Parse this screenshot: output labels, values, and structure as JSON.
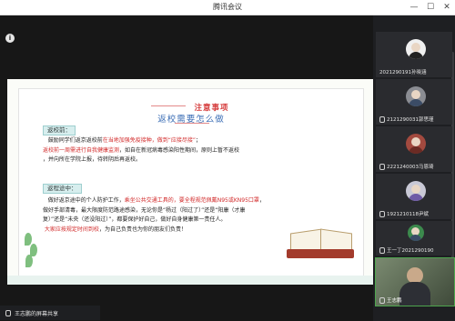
{
  "window": {
    "title": "腾讯会议",
    "minimize": "—",
    "maximize": "☐",
    "close": "✕"
  },
  "slide": {
    "banner_title": "注意事项",
    "heading": "返校需要怎么做",
    "sections": [
      {
        "label": "返校前：",
        "lines": [
          {
            "segments": [
              {
                "text": "鼓励同学们返京返校前",
                "red": false
              },
              {
                "text": "在当地加强免疫接种，做到“应接尽接”",
                "red": true
              },
              {
                "text": "；",
                "red": false
              }
            ]
          },
          {
            "segments": [
              {
                "text": "返校前一周需进行自我健康监测",
                "red": true
              },
              {
                "text": "，如自在新冠病毒感染阳性期间，原则上暂不返校",
                "red": false
              }
            ]
          },
          {
            "segments": [
              {
                "text": "，并向所在学院上报，待转阴后再返校。",
                "red": false
              }
            ]
          }
        ]
      },
      {
        "label": "返程途中：",
        "lines": [
          {
            "segments": [
              {
                "text": "做好返京途中的个人防护工作，",
                "red": false
              },
              {
                "text": "乘坐公共交通工具的，要全程规范佩戴N95或KN95口罩",
                "red": true
              },
              {
                "text": "，",
                "red": false
              }
            ]
          },
          {
            "segments": [
              {
                "text": "做好手部清毒，最大限度防范路途感染，无论你是“杨过（阳过了）”还是“阳康（才康",
                "red": false
              }
            ]
          },
          {
            "segments": [
              {
                "text": "复）”还是“未央（还没阳过）”，都要保护好自己，做好自身健康第一责任人。",
                "red": false
              }
            ]
          },
          {
            "segments": [
              {
                "text": "大家应按规定时间到校",
                "red": true
              },
              {
                "text": "，为自己负责也为你的朋友们负责！",
                "red": false
              }
            ]
          }
        ]
      }
    ]
  },
  "participants": [
    {
      "name": "2021290191孙晓涵"
    },
    {
      "name": "2121290031郭思瑾"
    },
    {
      "name": "2221240003马恩琦"
    },
    {
      "name": "1921210118尹斌"
    },
    {
      "name": "王一丁2021290190"
    }
  ],
  "self_view": {
    "name": "王志鹏"
  },
  "screen_share": {
    "label": "王志鹏的屏幕共享"
  }
}
